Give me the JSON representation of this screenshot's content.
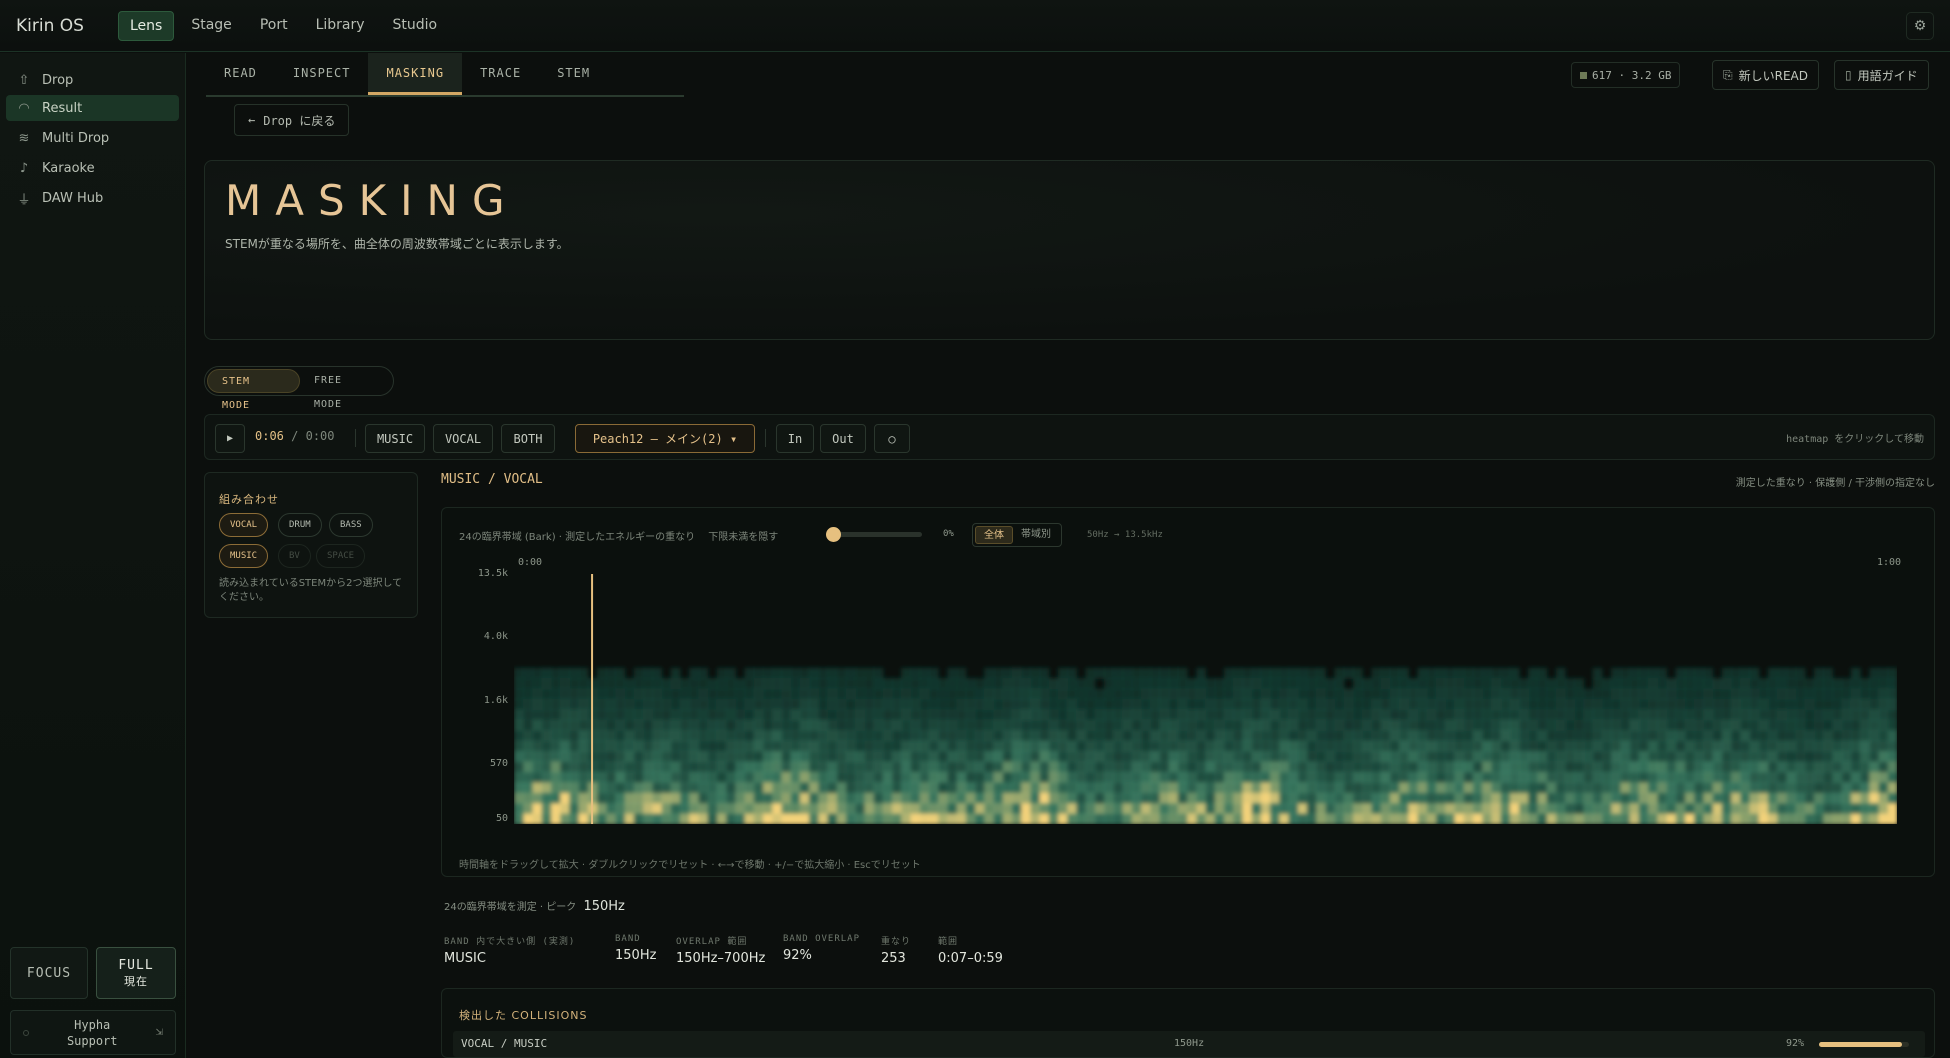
{
  "app": {
    "brand": "Kirin OS"
  },
  "topnav": [
    "Lens",
    "Stage",
    "Port",
    "Library",
    "Studio"
  ],
  "sidebar": {
    "items": [
      {
        "label": "Drop",
        "icon": "upload-icon"
      },
      {
        "label": "Result",
        "icon": "gauge-icon"
      },
      {
        "label": "Multi Drop",
        "icon": "layers-icon"
      },
      {
        "label": "Karaoke",
        "icon": "microphone-icon"
      },
      {
        "label": "DAW Hub",
        "icon": "plug-icon"
      }
    ],
    "focus": "FOCUS",
    "full": "FULL",
    "full_sub": "現在",
    "support_line1": "Hypha",
    "support_line2": "Support"
  },
  "tabs": [
    "READ",
    "INSPECT",
    "MASKING",
    "TRACE",
    "STEM"
  ],
  "header": {
    "storage": "617 · 3.2 GB",
    "new_read": "新しいREAD",
    "glossary": "用語ガイド",
    "back": "Drop に戻る"
  },
  "hero": {
    "title": "MASKING",
    "subtitle": "STEMが重なる場所を、曲全体の周波数帯域ごとに表示します。"
  },
  "mode": {
    "stem": "STEM MODE",
    "free": "FREE MODE"
  },
  "transport": {
    "time_current": "0:06",
    "time_total": "/ 0:00",
    "music": "MUSIC",
    "vocal": "VOCAL",
    "both": "BOTH",
    "preset": "Peach12 – メイン(2) ▾",
    "in": "In",
    "out": "Out",
    "loop": "○",
    "hint": "heatmap をクリックして移動"
  },
  "combo": {
    "title": "組み合わせ",
    "chips": [
      "VOCAL",
      "DRUM",
      "BASS",
      "MUSIC",
      "BV",
      "SPACE"
    ],
    "note": "読み込まれているSTEMから2つ選択してください。"
  },
  "pair": {
    "title": "MUSIC / VOCAL",
    "right": "測定した重なり · 保護側 / 干渉側の指定なし"
  },
  "heatmap": {
    "meta": "24の臨界帯域 (Bark) · 測定したエネルギーの重なり　 下限未満を隠す",
    "threshold": "0%",
    "seg_all": "全体",
    "seg_band": "帯域別",
    "range": "50Hz → 13.5kHz",
    "time_start": "0:00",
    "time_end": "1:00",
    "yticks": [
      "13.5k",
      "4.0k",
      "1.6k",
      "570",
      "50"
    ],
    "playhead_seconds": 6,
    "help": "時間軸をドラッグして拡大 · ダブルクリックでリセット · ←→で移動 · +/−で拡大縮小 · Escでリセット"
  },
  "summary": {
    "text": "24の臨界帯域を測定 · ピーク",
    "peak": "150Hz",
    "stats": [
      {
        "k": "BAND 内で大きい側 (実測)",
        "v": "MUSIC"
      },
      {
        "k": "BAND",
        "v": "150Hz"
      },
      {
        "k": "OVERLAP 範囲",
        "v": "150Hz–700Hz"
      },
      {
        "k": "BAND OVERLAP",
        "v": "92%"
      },
      {
        "k": "重なり",
        "v": "253"
      },
      {
        "k": "範囲",
        "v": "0:07–0:59"
      }
    ]
  },
  "collisions": {
    "title": "検出した COLLISIONS",
    "rows": [
      {
        "pair": "VOCAL / MUSIC",
        "band": "150Hz",
        "pct": "92%",
        "level": 0.92
      }
    ]
  },
  "colors": {
    "accent": "#e6c07f",
    "active_nav": "#1d3a28",
    "heat_low": "#0f4f45",
    "heat_high": "#f3d27a"
  }
}
